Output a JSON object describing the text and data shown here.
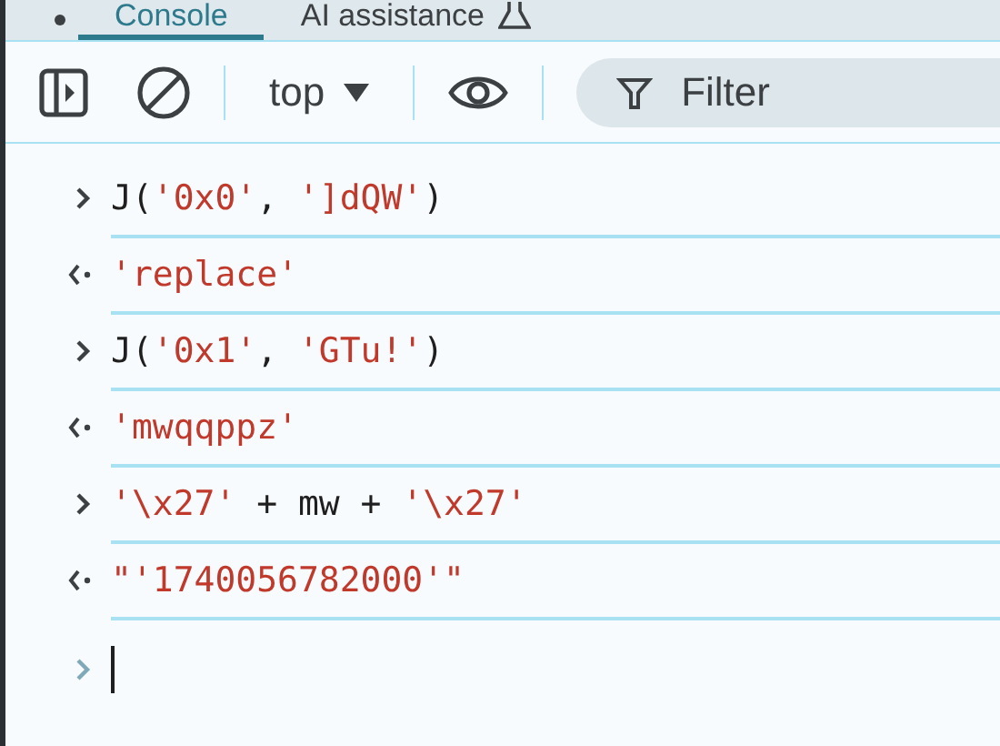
{
  "tabs": [
    {
      "label": "Console",
      "selected": true
    },
    {
      "label": "AI assistance",
      "selected": false
    }
  ],
  "toolbar": {
    "context": "top",
    "filter": {
      "placeholder": "Filter"
    }
  },
  "entries": [
    {
      "kind": "input",
      "parts": [
        {
          "text": "J(",
          "kind": "code"
        },
        {
          "text": "'0x0'",
          "kind": "string"
        },
        {
          "text": ", ",
          "kind": "code"
        },
        {
          "text": "']dQW'",
          "kind": "string"
        },
        {
          "text": ")",
          "kind": "code"
        }
      ]
    },
    {
      "kind": "output",
      "parts": [
        {
          "text": "'replace'",
          "kind": "string"
        }
      ]
    },
    {
      "kind": "input",
      "parts": [
        {
          "text": "J(",
          "kind": "code"
        },
        {
          "text": "'0x1'",
          "kind": "string"
        },
        {
          "text": ", ",
          "kind": "code"
        },
        {
          "text": "'GTu!'",
          "kind": "string"
        },
        {
          "text": ")",
          "kind": "code"
        }
      ]
    },
    {
      "kind": "output",
      "parts": [
        {
          "text": "'mwqqppz'",
          "kind": "string"
        }
      ]
    },
    {
      "kind": "input",
      "parts": [
        {
          "text": "'\\x27'",
          "kind": "string"
        },
        {
          "text": " + mw + ",
          "kind": "code"
        },
        {
          "text": "'\\x27'",
          "kind": "string"
        }
      ]
    },
    {
      "kind": "output",
      "parts": [
        {
          "text": "\"'1740056782000'\"",
          "kind": "string"
        }
      ]
    }
  ]
}
